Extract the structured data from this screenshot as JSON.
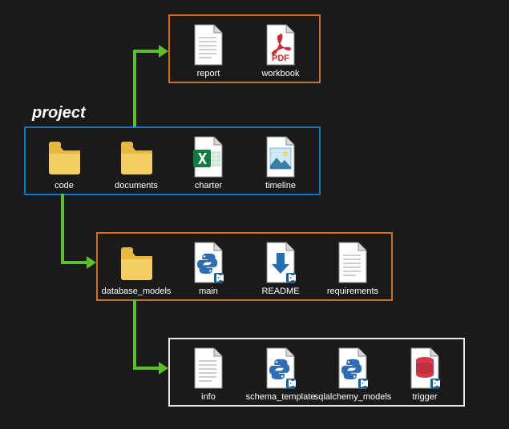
{
  "title": "project",
  "colors": {
    "accent_orange": "#d96b1a",
    "accent_blue": "#0078d4",
    "accent_white": "#e6e6e6",
    "arrow": "#5bbf2b",
    "bg": "#1a1a1a"
  },
  "documents_box": {
    "items": [
      {
        "name": "report",
        "icon": "text-document"
      },
      {
        "name": "workbook",
        "icon": "pdf-file"
      }
    ]
  },
  "project_box": {
    "items": [
      {
        "name": "code",
        "icon": "folder"
      },
      {
        "name": "documents",
        "icon": "folder"
      },
      {
        "name": "charter",
        "icon": "excel-file"
      },
      {
        "name": "timeline",
        "icon": "image-file"
      }
    ]
  },
  "code_box": {
    "items": [
      {
        "name": "database_models",
        "icon": "folder"
      },
      {
        "name": "main",
        "icon": "python-file"
      },
      {
        "name": "README",
        "icon": "markdown-file"
      },
      {
        "name": "requirements",
        "icon": "text-document"
      }
    ]
  },
  "db_models_box": {
    "items": [
      {
        "name": "info",
        "icon": "text-document"
      },
      {
        "name": "schema_template",
        "icon": "python-file"
      },
      {
        "name": "sqlalchemy_models",
        "icon": "python-file"
      },
      {
        "name": "trigger",
        "icon": "sql-file"
      }
    ]
  }
}
